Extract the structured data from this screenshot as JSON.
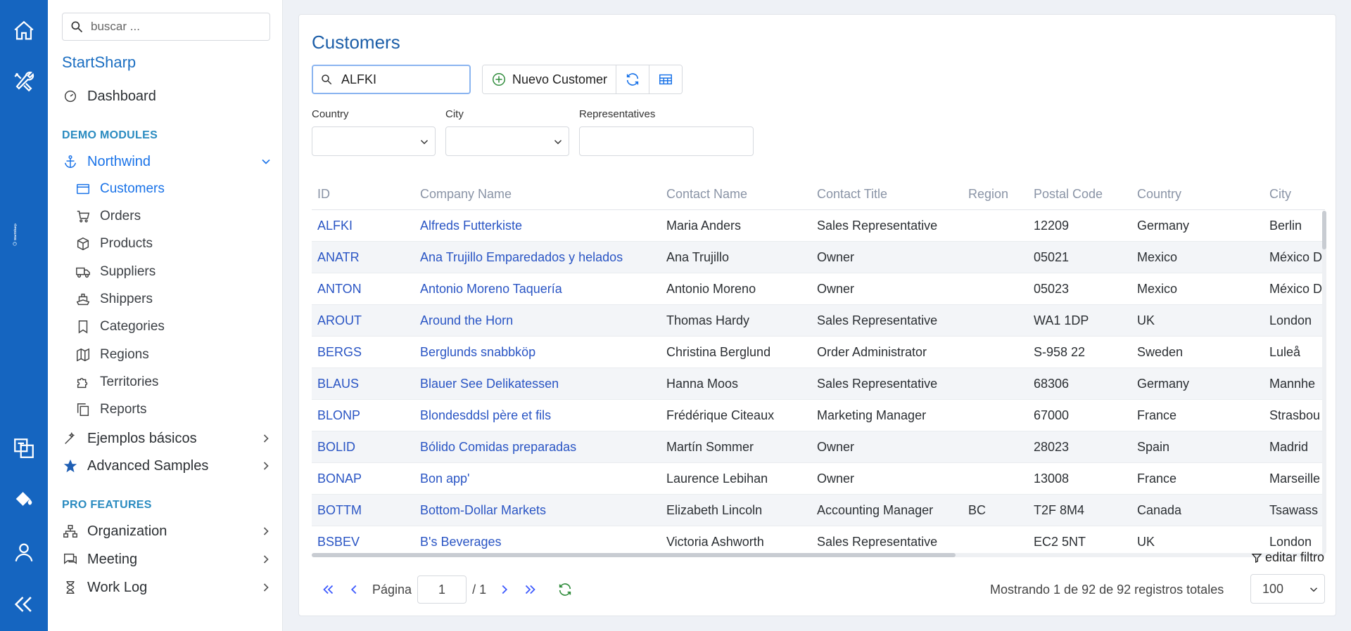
{
  "rail": {
    "brand": "StartSharp",
    "icons": [
      "home-icon",
      "tools-icon",
      "translate-icon",
      "paint-bucket-icon",
      "user-icon",
      "collapse-icon"
    ]
  },
  "sidebar": {
    "search_placeholder": "buscar ...",
    "brand": "StartSharp",
    "dashboard": "Dashboard",
    "section_demo": "DEMO MODULES",
    "northwind": "Northwind",
    "sub_items": [
      {
        "label": "Customers",
        "icon": "window-icon",
        "active": true
      },
      {
        "label": "Orders",
        "icon": "cart-icon"
      },
      {
        "label": "Products",
        "icon": "box-icon"
      },
      {
        "label": "Suppliers",
        "icon": "truck-icon"
      },
      {
        "label": "Shippers",
        "icon": "ship-icon"
      },
      {
        "label": "Categories",
        "icon": "bookmark-icon"
      },
      {
        "label": "Regions",
        "icon": "map-icon"
      },
      {
        "label": "Territories",
        "icon": "puzzle-icon"
      },
      {
        "label": "Reports",
        "icon": "copy-icon"
      }
    ],
    "ejemplos": "Ejemplos básicos",
    "advanced": "Advanced Samples",
    "section_pro": "PRO FEATURES",
    "organization": "Organization",
    "meeting": "Meeting",
    "worklog": "Work Log"
  },
  "main": {
    "title": "Customers",
    "quick_search_value": "ALFKI",
    "new_button": "Nuevo Customer",
    "filters": [
      {
        "label": "Country",
        "value": ""
      },
      {
        "label": "City",
        "value": ""
      },
      {
        "label": "Representatives",
        "value": ""
      }
    ],
    "columns": [
      "ID",
      "Company Name",
      "Contact Name",
      "Contact Title",
      "Region",
      "Postal Code",
      "Country",
      "City"
    ],
    "rows": [
      [
        "ALFKI",
        "Alfreds Futterkiste",
        "Maria Anders",
        "Sales Representative",
        "",
        "12209",
        "Germany",
        "Berlin"
      ],
      [
        "ANATR",
        "Ana Trujillo Emparedados y helados",
        "Ana Trujillo",
        "Owner",
        "",
        "05021",
        "Mexico",
        "México D"
      ],
      [
        "ANTON",
        "Antonio Moreno Taquería",
        "Antonio Moreno",
        "Owner",
        "",
        "05023",
        "Mexico",
        "México D"
      ],
      [
        "AROUT",
        "Around the Horn",
        "Thomas Hardy",
        "Sales Representative",
        "",
        "WA1 1DP",
        "UK",
        "London"
      ],
      [
        "BERGS",
        "Berglunds snabbköp",
        "Christina Berglund",
        "Order Administrator",
        "",
        "S-958 22",
        "Sweden",
        "Luleå"
      ],
      [
        "BLAUS",
        "Blauer See Delikatessen",
        "Hanna Moos",
        "Sales Representative",
        "",
        "68306",
        "Germany",
        "Mannhe"
      ],
      [
        "BLONP",
        "Blondesddsl père et fils",
        "Frédérique Citeaux",
        "Marketing Manager",
        "",
        "67000",
        "France",
        "Strasbou"
      ],
      [
        "BOLID",
        "Bólido Comidas preparadas",
        "Martín Sommer",
        "Owner",
        "",
        "28023",
        "Spain",
        "Madrid"
      ],
      [
        "BONAP",
        "Bon app'",
        "Laurence Lebihan",
        "Owner",
        "",
        "13008",
        "France",
        "Marseille"
      ],
      [
        "BOTTM",
        "Bottom-Dollar Markets",
        "Elizabeth Lincoln",
        "Accounting Manager",
        "BC",
        "T2F 8M4",
        "Canada",
        "Tsawass"
      ],
      [
        "BSBEV",
        "B's Beverages",
        "Victoria Ashworth",
        "Sales Representative",
        "",
        "EC2 5NT",
        "UK",
        "London"
      ]
    ],
    "edit_filter": "editar filtro",
    "pager": {
      "page_label": "Página",
      "page_value": "1",
      "page_total": "/ 1",
      "status": "Mostrando 1 de 92 de 92 registros totales",
      "page_size": "100"
    }
  },
  "colors": {
    "rail": "#1565c0",
    "accent": "#1a73e8",
    "link": "#2a55c4"
  }
}
